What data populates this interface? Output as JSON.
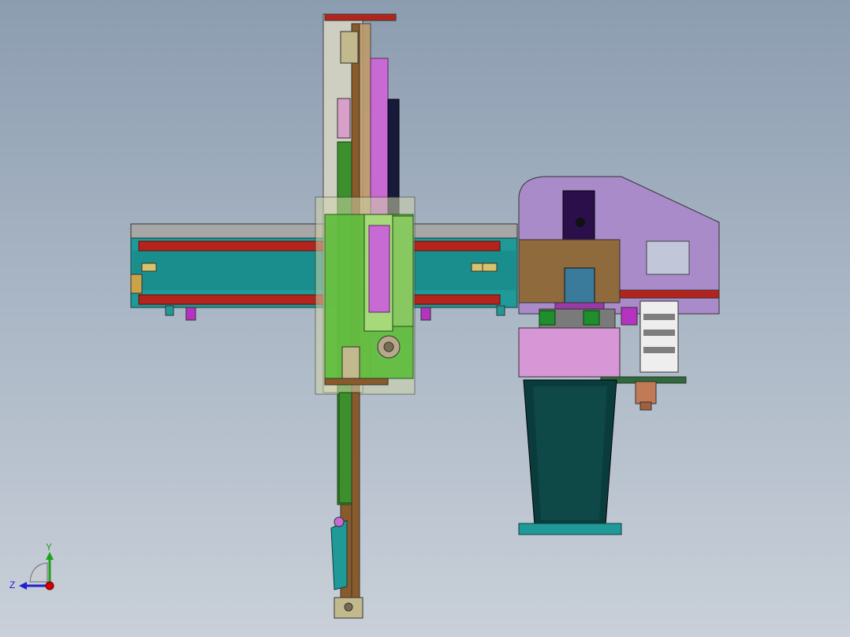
{
  "viewport": {
    "background_top": "#8c9db0",
    "background_bottom": "#c9d0d9"
  },
  "triad": {
    "x_color": "#d40000",
    "y_color": "#1fa01f",
    "z_color": "#2020d0",
    "y_label": "Y",
    "z_label": "Z"
  },
  "model": {
    "components": [
      "horizontal-beam",
      "vertical-column",
      "carriage-plate",
      "motor-housing",
      "servo-motor",
      "support-pedestal",
      "gripper-arm",
      "tool-head"
    ],
    "colors": {
      "beam": "#1f9a98",
      "rail": "#b5241c",
      "carriage": "#5dbd3a",
      "cylinder": "#c86ad4",
      "housing": "#a98bc9",
      "pedestal": "#0a3c3d",
      "bracket": "#8e6a3c"
    }
  }
}
